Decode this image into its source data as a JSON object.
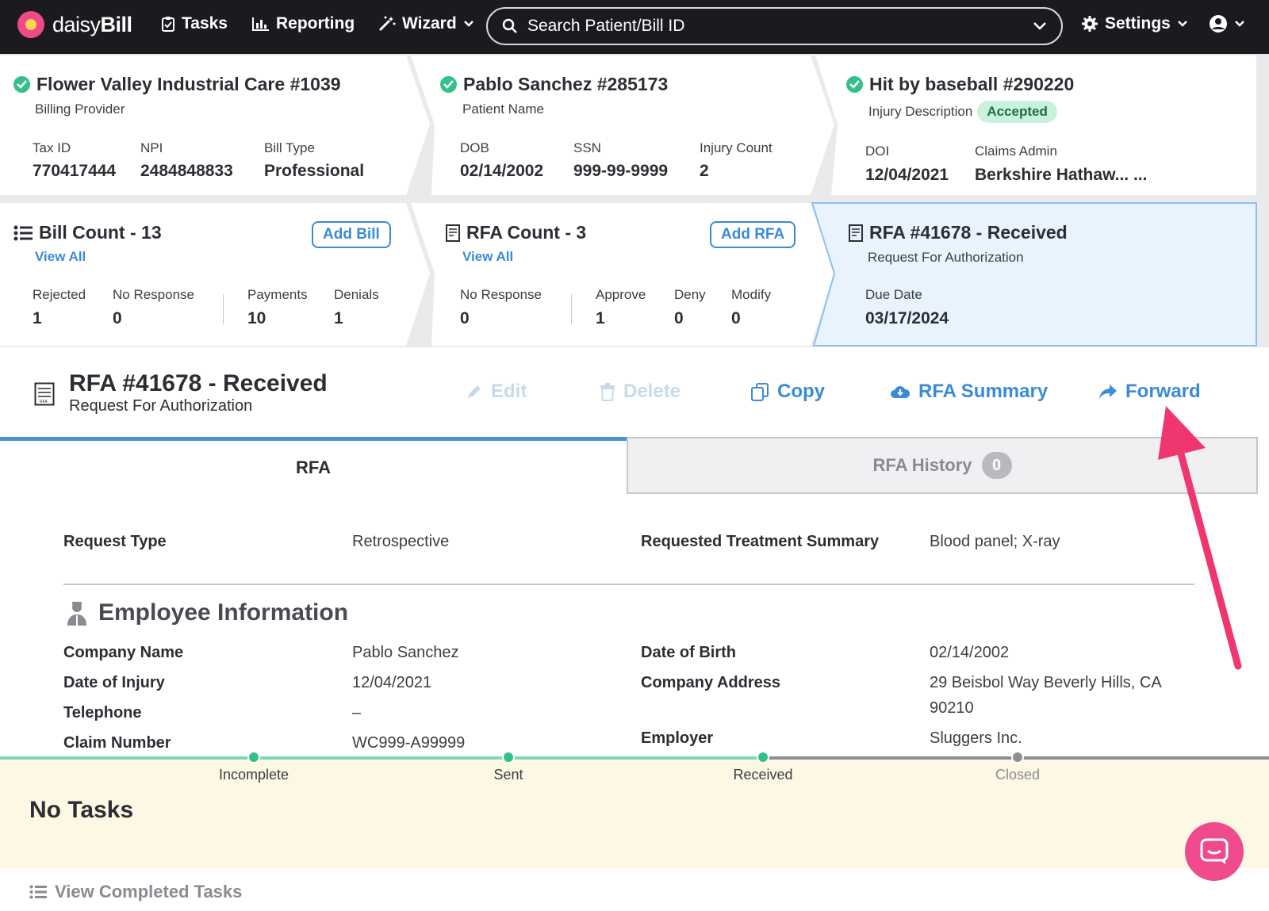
{
  "nav": {
    "logo_text_light": "daisy",
    "logo_text_bold": "Bill",
    "tasks": "Tasks",
    "reporting": "Reporting",
    "wizard": "Wizard",
    "search_placeholder": "Search Patient/Bill ID",
    "settings": "Settings"
  },
  "provider": {
    "title": "Flower Valley Industrial Care #1039",
    "subtitle": "Billing Provider",
    "fields": [
      {
        "label": "Tax ID",
        "value": "770417444"
      },
      {
        "label": "NPI",
        "value": "2484848833"
      },
      {
        "label": "Bill Type",
        "value": "Professional"
      }
    ]
  },
  "patient": {
    "title": "Pablo Sanchez #285173",
    "subtitle": "Patient Name",
    "fields": [
      {
        "label": "DOB",
        "value": "02/14/2002"
      },
      {
        "label": "SSN",
        "value": "999-99-9999"
      },
      {
        "label": "Injury Count",
        "value": "2"
      }
    ]
  },
  "injury": {
    "title": "Hit by baseball #290220",
    "subtitle": "Injury Description",
    "status": "Accepted",
    "fields": [
      {
        "label": "DOI",
        "value": "12/04/2021"
      },
      {
        "label": "Claims Admin",
        "value": "Berkshire Hathaw... ..."
      }
    ]
  },
  "bills": {
    "title": "Bill Count - 13",
    "view_all": "View All",
    "add": "Add Bill",
    "stats": [
      {
        "label": "Rejected",
        "value": "1"
      },
      {
        "label": "No Response",
        "value": "0"
      },
      {
        "label": "Payments",
        "value": "10"
      },
      {
        "label": "Denials",
        "value": "1"
      }
    ]
  },
  "rfas": {
    "title": "RFA Count - 3",
    "view_all": "View All",
    "add": "Add RFA",
    "stats": [
      {
        "label": "No Response",
        "value": "0"
      },
      {
        "label": "Approve",
        "value": "1"
      },
      {
        "label": "Deny",
        "value": "0"
      },
      {
        "label": "Modify",
        "value": "0"
      }
    ]
  },
  "current_rfa": {
    "title": "RFA #41678 - Received",
    "subtitle": "Request For Authorization",
    "due_label": "Due Date",
    "due_value": "03/17/2024"
  },
  "header": {
    "title": "RFA #41678 - Received",
    "subtitle": "Request For Authorization",
    "actions": {
      "edit": "Edit",
      "delete": "Delete",
      "copy": "Copy",
      "summary": "RFA Summary",
      "forward": "Forward"
    }
  },
  "tabs": {
    "rfa": "RFA",
    "history": "RFA History",
    "history_count": "0"
  },
  "request": {
    "type_label": "Request Type",
    "type_value": "Retrospective",
    "summary_label": "Requested Treatment Summary",
    "summary_value": "Blood panel; X-ray"
  },
  "employee": {
    "heading": "Employee Information",
    "company_name_label": "Company Name",
    "company_name_value": "Pablo Sanchez",
    "doi_label": "Date of Injury",
    "doi_value": "12/04/2021",
    "telephone_label": "Telephone",
    "telephone_value": "–",
    "claim_label": "Claim Number",
    "claim_value": "WC999-A99999",
    "dob_label": "Date of Birth",
    "dob_value": "02/14/2002",
    "address_label": "Company Address",
    "address_line1": "29 Beisbol Way Beverly Hills, CA",
    "address_line2": "90210",
    "employer_label": "Employer",
    "employer_value": "Sluggers Inc."
  },
  "progress": {
    "steps": [
      "Incomplete",
      "Sent",
      "Received",
      "Closed"
    ],
    "completed_steps": 3
  },
  "tasks": {
    "empty": "No Tasks",
    "view_completed": "View Completed Tasks"
  },
  "colors": {
    "accent": "#3a8bd6",
    "success": "#35c08a",
    "annotation_arrow": "#f0366f",
    "chat": "#ef4a8c"
  }
}
